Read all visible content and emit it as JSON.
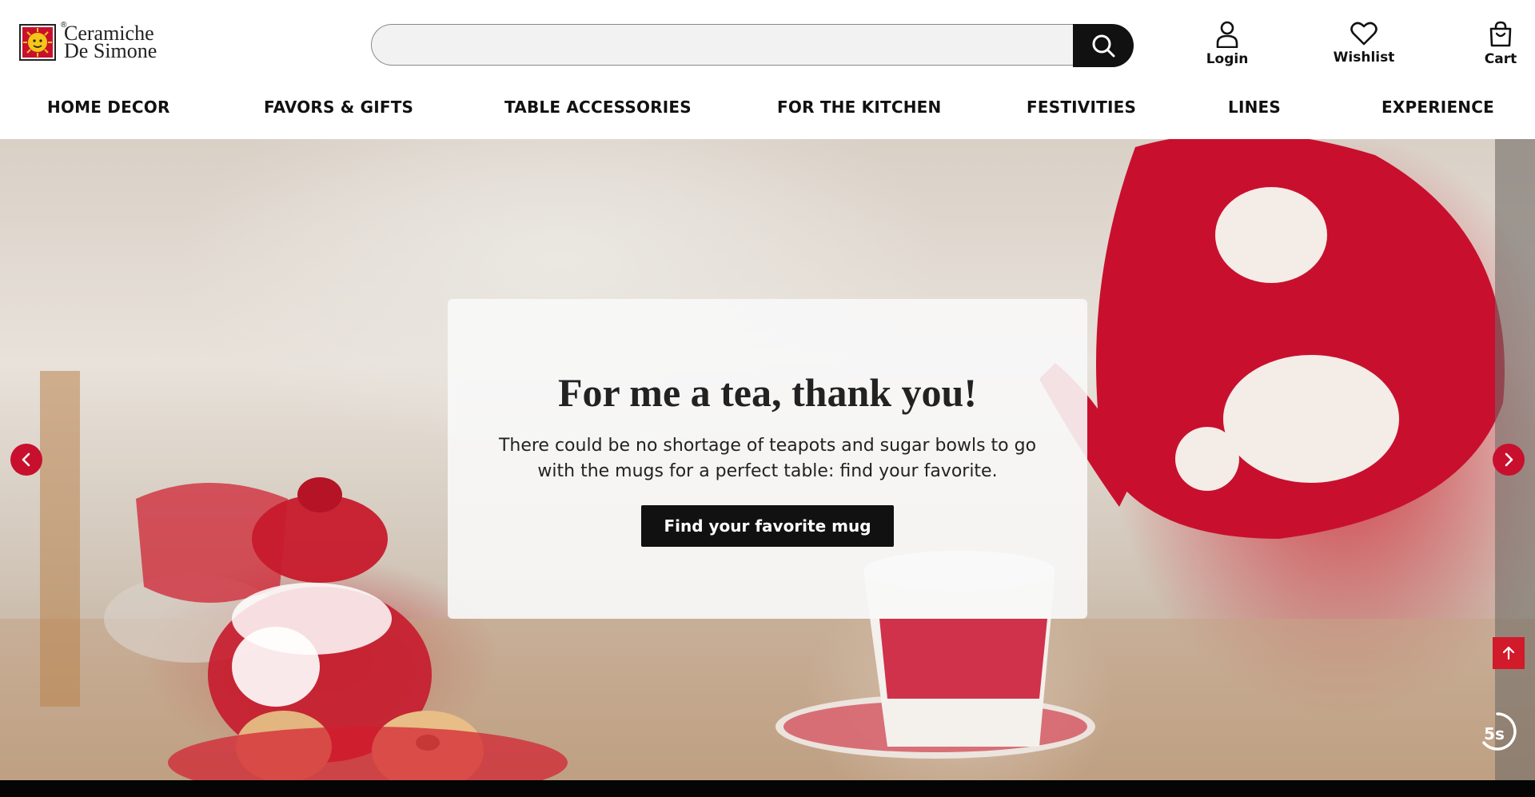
{
  "brand": {
    "logo_line1": "Ceramiche",
    "logo_line2": "De Simone",
    "registered_mark": "®",
    "logo_icon": "sun-face-logo"
  },
  "search": {
    "value": "",
    "placeholder": "",
    "button_icon": "search-icon"
  },
  "header_actions": {
    "login": {
      "label": "Login",
      "icon": "user-icon"
    },
    "wishlist": {
      "label": "Wishlist",
      "icon": "heart-icon"
    },
    "cart": {
      "label": "Cart",
      "icon": "shopping-bag-icon"
    }
  },
  "nav": {
    "items": [
      {
        "label": "HOME DECOR"
      },
      {
        "label": "FAVORS & GIFTS"
      },
      {
        "label": "TABLE ACCESSORIES"
      },
      {
        "label": "FOR THE KITCHEN"
      },
      {
        "label": "FESTIVITIES"
      },
      {
        "label": "LINES"
      },
      {
        "label": "EXPERIENCE"
      }
    ]
  },
  "hero": {
    "title": "For me a tea, thank you!",
    "text": "There could be no shortage of teapots and sugar bowls to go with the mugs for a perfect table: find your favorite.",
    "cta_label": "Find your favorite mug",
    "prev_icon": "chevron-left-icon",
    "next_icon": "chevron-right-icon",
    "autoplay_timer": "5s"
  },
  "scroll_top_icon": "arrow-up-icon",
  "colors": {
    "accent_red": "#c8102e",
    "black": "#111111",
    "card_bg": "#f8f8f8",
    "search_bg": "#f2f2f2"
  }
}
